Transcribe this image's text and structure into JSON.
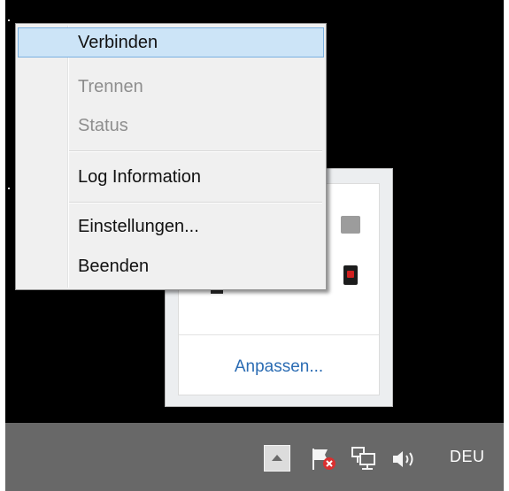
{
  "context_menu": {
    "items": [
      {
        "label": "Verbinden",
        "state": "highlighted"
      },
      {
        "label": "Trennen",
        "state": "disabled"
      },
      {
        "label": "Status",
        "state": "disabled"
      },
      {
        "label": "Log Information",
        "state": "enabled"
      },
      {
        "label": "Einstellungen...",
        "state": "enabled"
      },
      {
        "label": "Beenden",
        "state": "enabled"
      }
    ]
  },
  "tray_popup": {
    "customize_link": "Anpassen..."
  },
  "taskbar": {
    "language": "DEU",
    "icons": [
      "show-hidden-icons-arrow",
      "action-center-flag-icon",
      "network-icon",
      "volume-icon"
    ]
  },
  "colors": {
    "desktop": "#000000",
    "taskbar": "#686868",
    "menu_background": "#f0f0f0",
    "menu_highlight": "#cce4f7",
    "link": "#2b6cb3",
    "disabled_text": "#8e8e8e"
  }
}
